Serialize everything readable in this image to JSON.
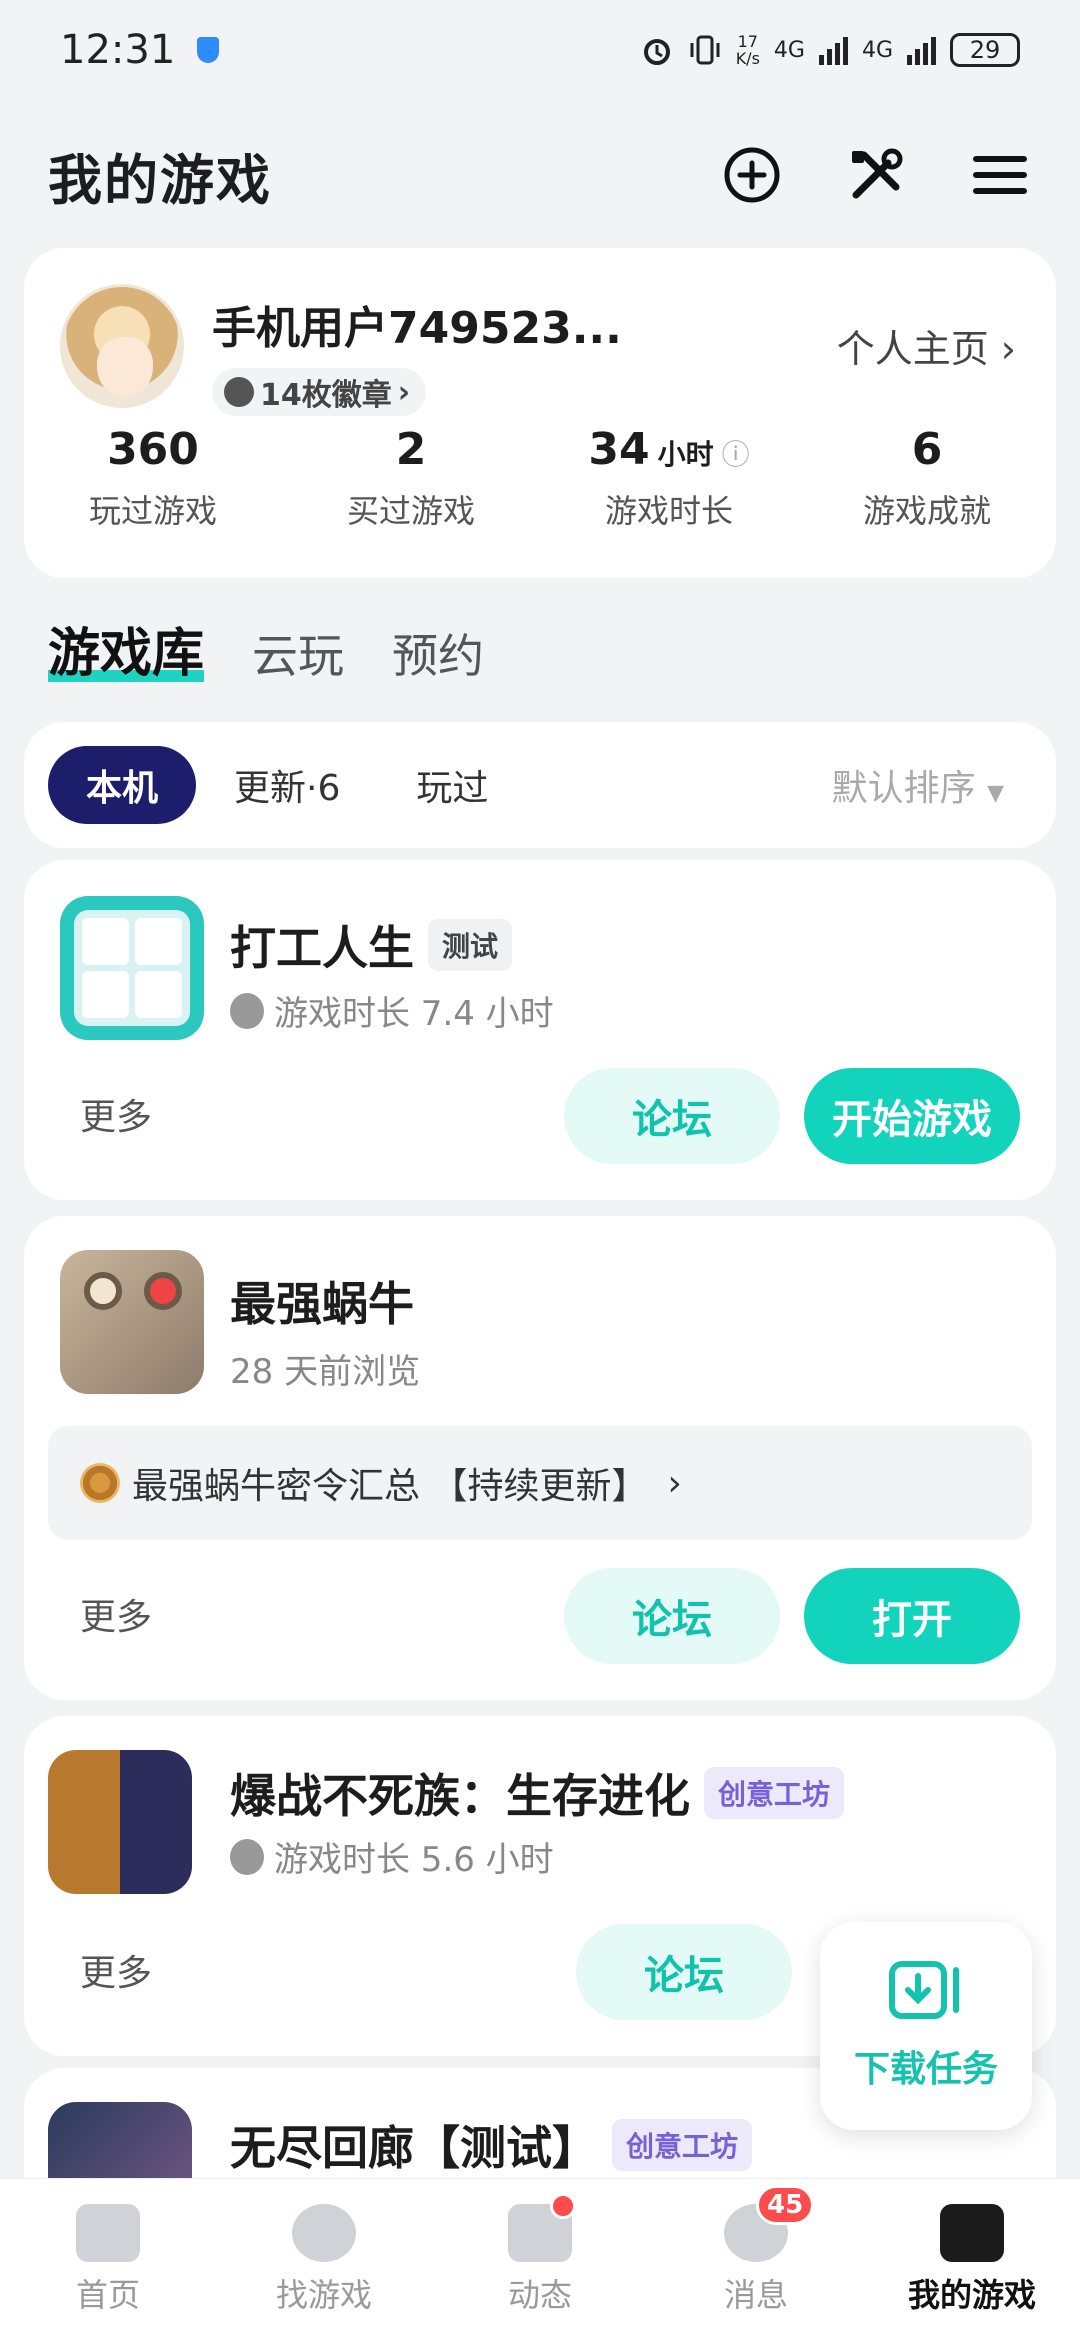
{
  "status": {
    "time": "12:31",
    "speed_value": "17",
    "speed_unit": "K/s",
    "net1": "4G",
    "net2": "4G",
    "battery": "29"
  },
  "header": {
    "title": "我的游戏"
  },
  "profile": {
    "username": "手机用户749523...",
    "badges": "14枚徽章",
    "home_link": "个人主页",
    "stats": [
      {
        "value": "360",
        "unit": "",
        "label": "玩过游戏"
      },
      {
        "value": "2",
        "unit": "",
        "label": "买过游戏"
      },
      {
        "value": "34",
        "unit": "小时",
        "label": "游戏时长"
      },
      {
        "value": "6",
        "unit": "",
        "label": "游戏成就"
      }
    ]
  },
  "tabs": [
    "游戏库",
    "云玩",
    "预约"
  ],
  "filter": {
    "chips": [
      "本机",
      "更新·6",
      "玩过"
    ],
    "sort": "默认排序"
  },
  "games": [
    {
      "title": "打工人生",
      "tag": "测试",
      "sub": "游戏时长 7.4 小时",
      "more": "更多",
      "forum": "论坛",
      "action": "开始游戏"
    },
    {
      "title": "最强蜗牛",
      "sub": "28 天前浏览",
      "notice": "最强蜗牛密令汇总 【持续更新】",
      "more": "更多",
      "forum": "论坛",
      "action": "打开"
    },
    {
      "title": "爆战不死族：生存进化",
      "tag": "创意工坊",
      "sub": "游戏时长 5.6 小时",
      "more": "更多",
      "forum": "论坛"
    },
    {
      "title": "无尽回廊【测试】",
      "tag": "创意工坊"
    }
  ],
  "fab": {
    "label": "下载任务"
  },
  "nav": {
    "items": [
      {
        "label": "首页"
      },
      {
        "label": "找游戏"
      },
      {
        "label": "动态"
      },
      {
        "label": "消息",
        "count": "45"
      },
      {
        "label": "我的游戏"
      }
    ]
  },
  "colors": {
    "accent": "#12d4bd",
    "active_chip": "#1d1e6b",
    "badge_red": "#ff4b4b"
  }
}
